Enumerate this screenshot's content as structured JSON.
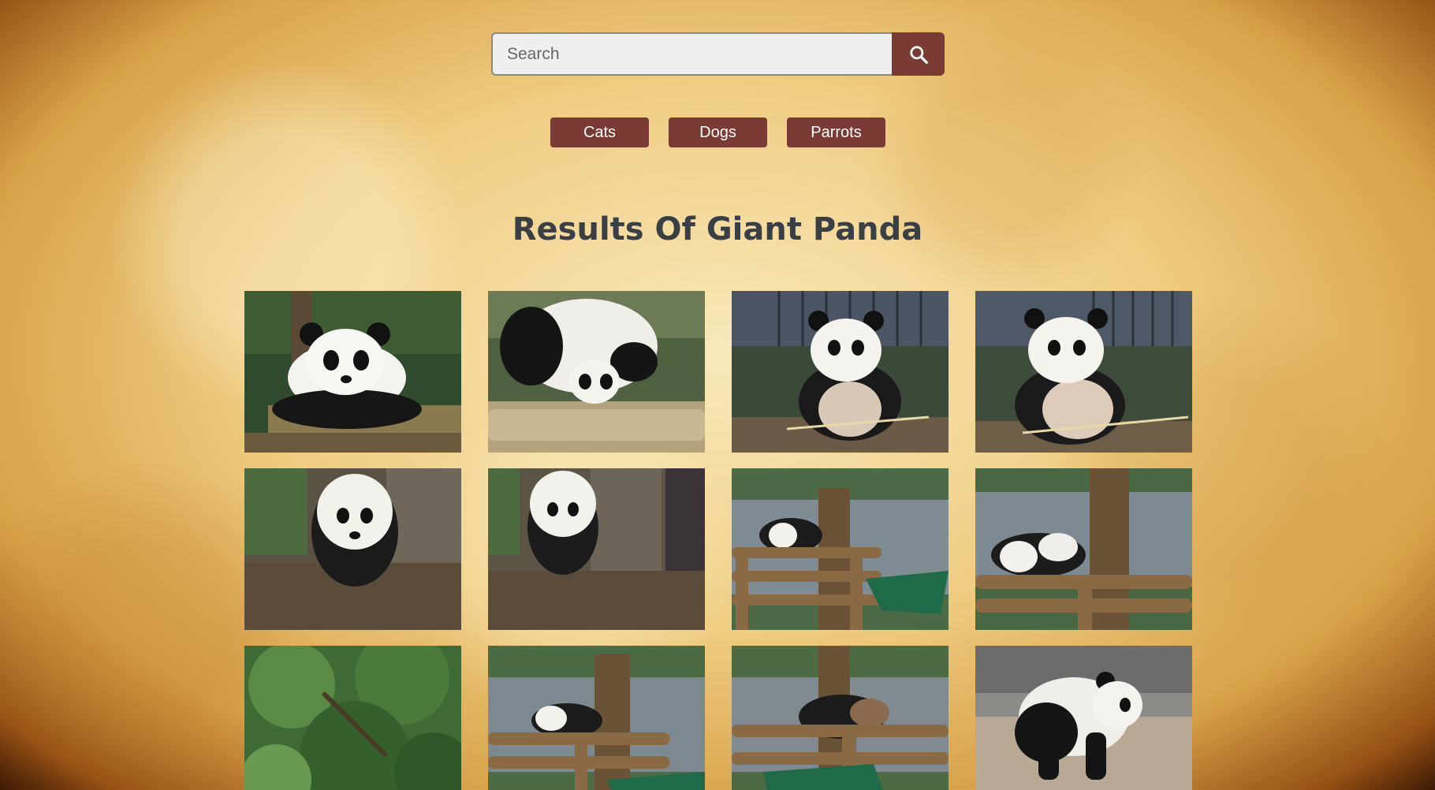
{
  "search": {
    "placeholder": "Search",
    "value": ""
  },
  "search_button_icon": "search-icon",
  "categories": [
    {
      "label": "Cats"
    },
    {
      "label": "Dogs"
    },
    {
      "label": "Parrots"
    }
  ],
  "results_title": "Results Of Giant Panda",
  "images": [
    {
      "subject": "panda-lying-on-log"
    },
    {
      "subject": "panda-eating-bamboo"
    },
    {
      "subject": "panda-sitting-eating"
    },
    {
      "subject": "panda-sitting-bamboo"
    },
    {
      "subject": "panda-walking-tree"
    },
    {
      "subject": "panda-by-tree"
    },
    {
      "subject": "panda-on-wooden-frame"
    },
    {
      "subject": "panda-resting-frame"
    },
    {
      "subject": "green-foliage"
    },
    {
      "subject": "panda-in-enclosure"
    },
    {
      "subject": "panda-climbing-frame"
    },
    {
      "subject": "panda-walking-ground"
    }
  ],
  "colors": {
    "accent": "#7a3b34",
    "title": "#3a3f46",
    "search_bg": "#efefef"
  }
}
